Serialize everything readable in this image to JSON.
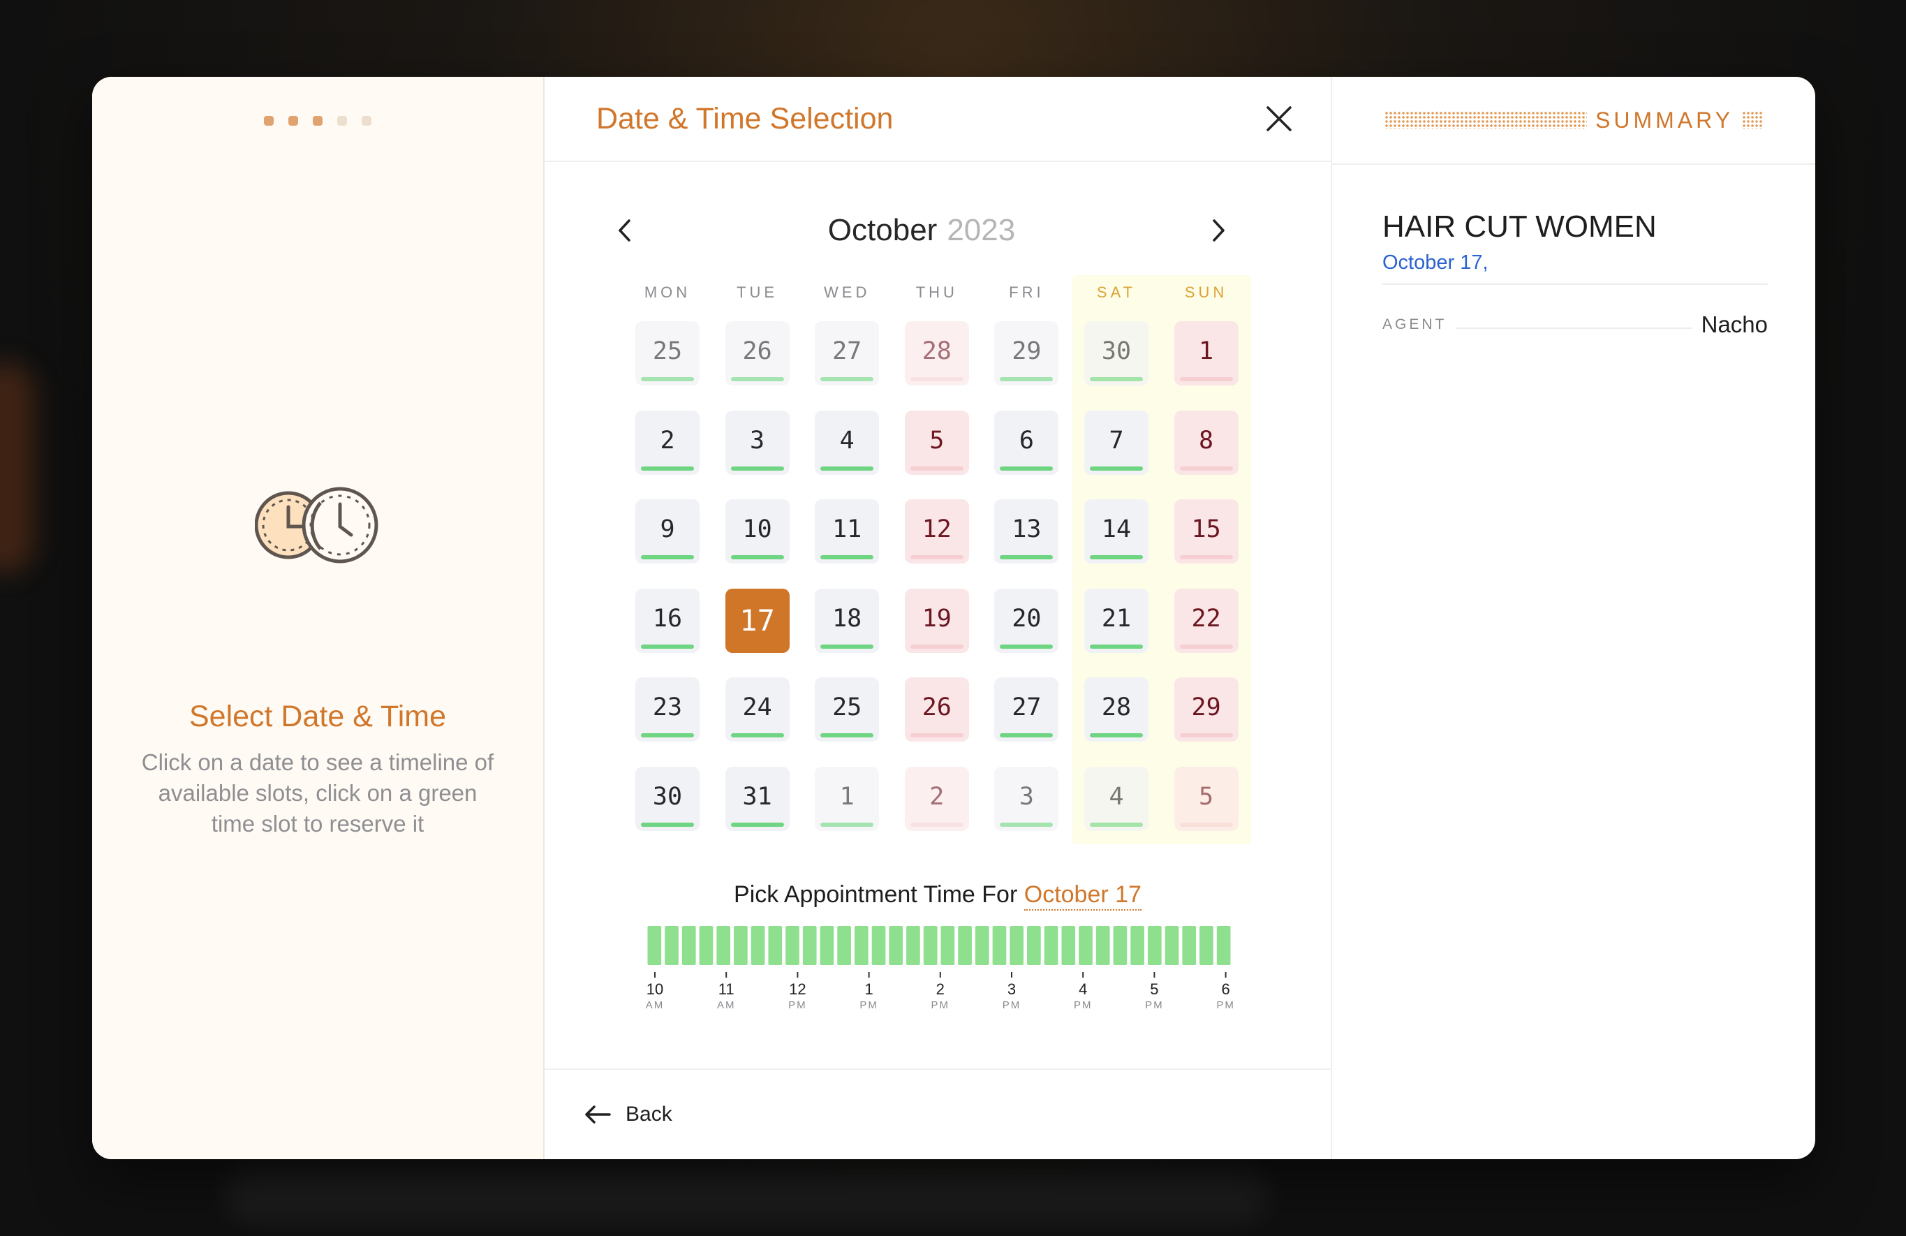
{
  "steps": {
    "total": 5,
    "completed": 3
  },
  "left": {
    "illustration_icon": "double-clock-icon",
    "title": "Select Date & Time",
    "description": "Click on a date to see a timeline of available slots, click on a green time slot to reserve it"
  },
  "header": {
    "title": "Date & Time Selection",
    "close_icon": "close-icon"
  },
  "calendar": {
    "month": "October",
    "year": "2023",
    "prev_icon": "chevron-left-icon",
    "next_icon": "chevron-right-icon",
    "weekdays": [
      "MON",
      "TUE",
      "WED",
      "THU",
      "FRI",
      "SAT",
      "SUN"
    ],
    "weeks": [
      [
        {
          "d": "25",
          "s": "avail",
          "o": true
        },
        {
          "d": "26",
          "s": "avail",
          "o": true
        },
        {
          "d": "27",
          "s": "avail",
          "o": true
        },
        {
          "d": "28",
          "s": "off",
          "o": true
        },
        {
          "d": "29",
          "s": "avail",
          "o": true
        },
        {
          "d": "30",
          "s": "avail",
          "o": true
        },
        {
          "d": "1",
          "s": "off",
          "o": false
        }
      ],
      [
        {
          "d": "2",
          "s": "avail",
          "o": false
        },
        {
          "d": "3",
          "s": "avail",
          "o": false
        },
        {
          "d": "4",
          "s": "avail",
          "o": false
        },
        {
          "d": "5",
          "s": "off",
          "o": false
        },
        {
          "d": "6",
          "s": "avail",
          "o": false
        },
        {
          "d": "7",
          "s": "avail",
          "o": false
        },
        {
          "d": "8",
          "s": "off",
          "o": false
        }
      ],
      [
        {
          "d": "9",
          "s": "avail",
          "o": false
        },
        {
          "d": "10",
          "s": "avail",
          "o": false
        },
        {
          "d": "11",
          "s": "avail",
          "o": false
        },
        {
          "d": "12",
          "s": "off",
          "o": false
        },
        {
          "d": "13",
          "s": "avail",
          "o": false
        },
        {
          "d": "14",
          "s": "avail",
          "o": false
        },
        {
          "d": "15",
          "s": "off",
          "o": false
        }
      ],
      [
        {
          "d": "16",
          "s": "avail",
          "o": false
        },
        {
          "d": "17",
          "s": "selected",
          "o": false
        },
        {
          "d": "18",
          "s": "avail",
          "o": false
        },
        {
          "d": "19",
          "s": "off",
          "o": false
        },
        {
          "d": "20",
          "s": "avail",
          "o": false
        },
        {
          "d": "21",
          "s": "avail",
          "o": false
        },
        {
          "d": "22",
          "s": "off",
          "o": false
        }
      ],
      [
        {
          "d": "23",
          "s": "avail",
          "o": false
        },
        {
          "d": "24",
          "s": "avail",
          "o": false
        },
        {
          "d": "25",
          "s": "avail",
          "o": false
        },
        {
          "d": "26",
          "s": "off",
          "o": false
        },
        {
          "d": "27",
          "s": "avail",
          "o": false
        },
        {
          "d": "28",
          "s": "avail",
          "o": false
        },
        {
          "d": "29",
          "s": "off",
          "o": false
        }
      ],
      [
        {
          "d": "30",
          "s": "avail",
          "o": false
        },
        {
          "d": "31",
          "s": "avail",
          "o": false
        },
        {
          "d": "1",
          "s": "avail",
          "o": true
        },
        {
          "d": "2",
          "s": "off",
          "o": true
        },
        {
          "d": "3",
          "s": "avail",
          "o": true
        },
        {
          "d": "4",
          "s": "avail",
          "o": true
        },
        {
          "d": "5",
          "s": "off",
          "o": true
        }
      ]
    ]
  },
  "timepicker": {
    "label_prefix": "Pick Appointment Time For",
    "selected_date": "October 17",
    "slot_count": 34,
    "slot_color": "#8ee08e",
    "ticks": [
      {
        "hour": "10",
        "ampm": "AM"
      },
      {
        "hour": "11",
        "ampm": "AM"
      },
      {
        "hour": "12",
        "ampm": "PM"
      },
      {
        "hour": "1",
        "ampm": "PM"
      },
      {
        "hour": "2",
        "ampm": "PM"
      },
      {
        "hour": "3",
        "ampm": "PM"
      },
      {
        "hour": "4",
        "ampm": "PM"
      },
      {
        "hour": "5",
        "ampm": "PM"
      },
      {
        "hour": "6",
        "ampm": "PM"
      }
    ]
  },
  "footer": {
    "back_label": "Back",
    "back_icon": "arrow-left-icon"
  },
  "summary": {
    "title": "SUMMARY",
    "service": "HAIR CUT WOMEN",
    "date": "October 17,",
    "agent_label": "AGENT",
    "agent_name": "Nacho"
  },
  "colors": {
    "accent": "#d0772c",
    "available": "#6fd583",
    "unavailable_bg": "#fbe6e7",
    "link_blue": "#2c62cf"
  }
}
